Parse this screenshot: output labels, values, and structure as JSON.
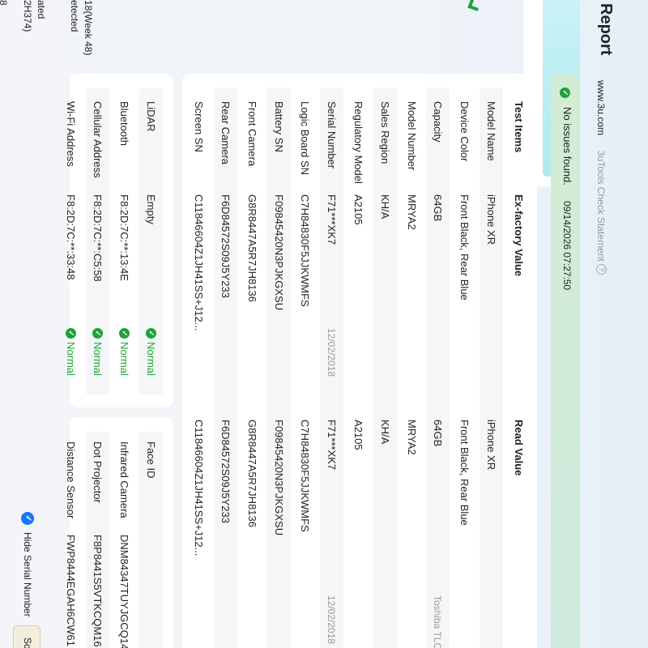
{
  "header": {
    "title": "Report",
    "site": "www.3u.com",
    "statement": "3uTools Check Statement",
    "help_glyph": "?"
  },
  "left_edge": {
    "line1": "8",
    "line2": "2H374)",
    "line3": "ated",
    "line4": "etected",
    "line5": "18(Week 48)"
  },
  "status": {
    "message": "No issues found.",
    "datetime": "09/14/2026 07:27:50"
  },
  "table": {
    "headers": [
      "Test Items",
      "Ex-factory Value",
      "Read Value"
    ],
    "rows": [
      {
        "item": "Model Name",
        "factory": "iPhone XR",
        "read": "iPhone XR",
        "extra": ""
      },
      {
        "item": "Device Color",
        "factory": "Front Black,  Rear Blue",
        "read": "Front Black,  Rear Blue",
        "extra": ""
      },
      {
        "item": "Capacity",
        "factory": "64GB",
        "read": "64GB",
        "extra": "Toshiba TLC"
      },
      {
        "item": "Model Number",
        "factory": "MRYA2",
        "read": "MRYA2",
        "extra": ""
      },
      {
        "item": "Sales Region",
        "factory": "KH/A",
        "read": "KH/A",
        "extra": ""
      },
      {
        "item": "Regulatory Model",
        "factory": "A2105",
        "read": "A2105",
        "extra": ""
      },
      {
        "item": "Serial Number",
        "factory": "F71***XK7",
        "read": "F71***XK7",
        "date1": "12/02/2018",
        "extra": "12/02/2018"
      },
      {
        "item": "Logic Board SN",
        "factory": "C7H84830F5JJKWMFS",
        "read": "C7H84830F5JJKWMFS",
        "extra": ""
      },
      {
        "item": "Battery SN",
        "factory": "F09845420N3PJKGXSU",
        "read": "F09845420N3PJKGXSU",
        "extra": ""
      },
      {
        "item": "Front Camera",
        "factory": "G8R8447A5R7JH8136",
        "read": "G8R8447A5R7JH8136",
        "extra": ""
      },
      {
        "item": "Rear Camera",
        "factory": "F6D84572S09J5Y233",
        "read": "F6D84572S09J5Y233",
        "extra": ""
      },
      {
        "item": "Screen SN",
        "factory": "C11846604Z1JH41SS+J12...",
        "read": "C11846604Z1JH41SS+J12...",
        "extra": ""
      }
    ]
  },
  "bottom_left": {
    "rows": [
      {
        "item": "LiDAR",
        "value": "Empty",
        "status": "Normal"
      },
      {
        "item": "Bluetooth",
        "value": "F8:2D:7C:**:13:4E",
        "status": "Normal"
      },
      {
        "item": "Cellular Address",
        "value": "F8:2D:7C:**:C5:58",
        "status": "Normal"
      },
      {
        "item": "Wi-Fi Address",
        "value": "F8:2D:7C:**:33:48",
        "status": "Normal"
      }
    ]
  },
  "bottom_right": {
    "rows": [
      {
        "item": "Face ID",
        "value": ""
      },
      {
        "item": "Infrared Camera",
        "value": "DNM84347TUYJGCQ14"
      },
      {
        "item": "Dot Projector",
        "value": "F8P8441S5VTKCQM16"
      },
      {
        "item": "Distance Sensor",
        "value": "FWP8444EGAH6CW61"
      }
    ]
  },
  "footer": {
    "hide_serial": "Hide Serial Number",
    "button_partial": "Sc"
  },
  "colors": {
    "green": "#1fa23a",
    "blue": "#1677ff",
    "banner": "#d3ecd4"
  }
}
